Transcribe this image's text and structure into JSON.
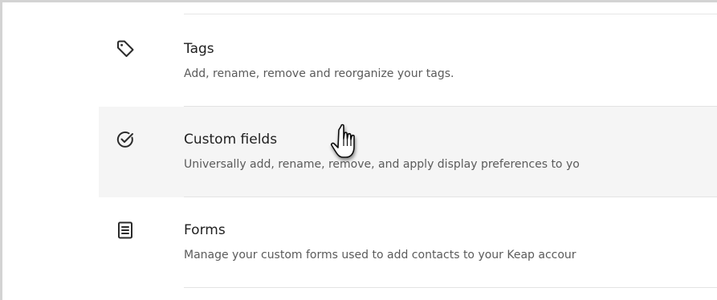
{
  "settings_list": {
    "items": [
      {
        "icon": "tag-icon",
        "title": "Tags",
        "description": "Add, rename, remove and reorganize your tags."
      },
      {
        "icon": "check-circle-icon",
        "title": "Custom fields",
        "description": "Universally add, rename, remove, and apply display preferences to yo"
      },
      {
        "icon": "form-document-icon",
        "title": "Forms",
        "description": "Manage your custom forms used to add contacts to your Keap accour"
      }
    ]
  },
  "hovered_item": "Custom fields",
  "colors": {
    "background": "#ffffff",
    "hover_background": "#f5f5f5",
    "divider": "#e3e3e3",
    "title_text": "#1f1f1f",
    "description_text": "#5b5b5b"
  }
}
